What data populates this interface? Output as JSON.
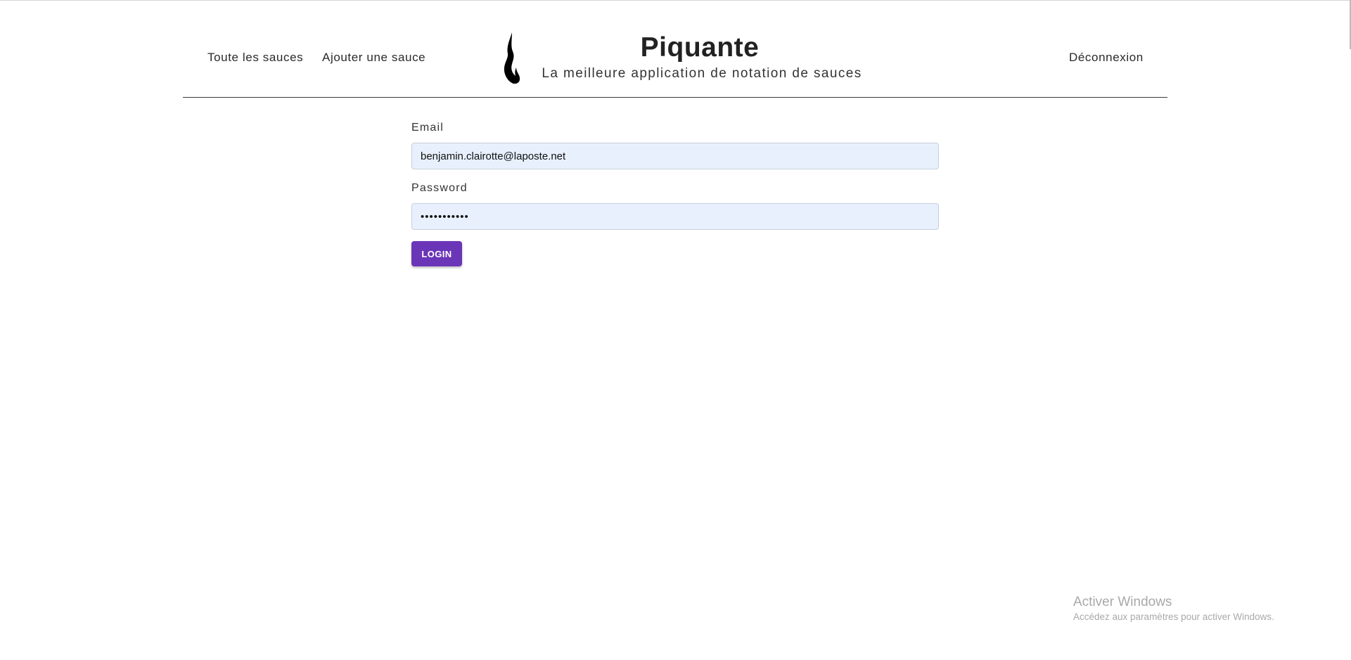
{
  "header": {
    "nav": {
      "all_sauces": "Toute les sauces",
      "add_sauce": "Ajouter une sauce",
      "logout": "Déconnexion"
    },
    "brand": {
      "title": "Piquante",
      "subtitle": "La meilleure application de notation de sauces",
      "logo_icon": "flame-icon"
    }
  },
  "login_form": {
    "email": {
      "label": "Email",
      "value": "benjamin.clairotte@laposte.net"
    },
    "password": {
      "label": "Password",
      "value": "•••••••••••"
    },
    "submit_label": "LOGIN"
  },
  "windows_watermark": {
    "title": "Activer Windows",
    "subtitle": "Accédez aux paramètres pour activer Windows."
  },
  "colors": {
    "accent": "#6b35b8",
    "input_background": "#e8f0fd",
    "text": "#222222",
    "watermark": "#a9a9a9"
  }
}
